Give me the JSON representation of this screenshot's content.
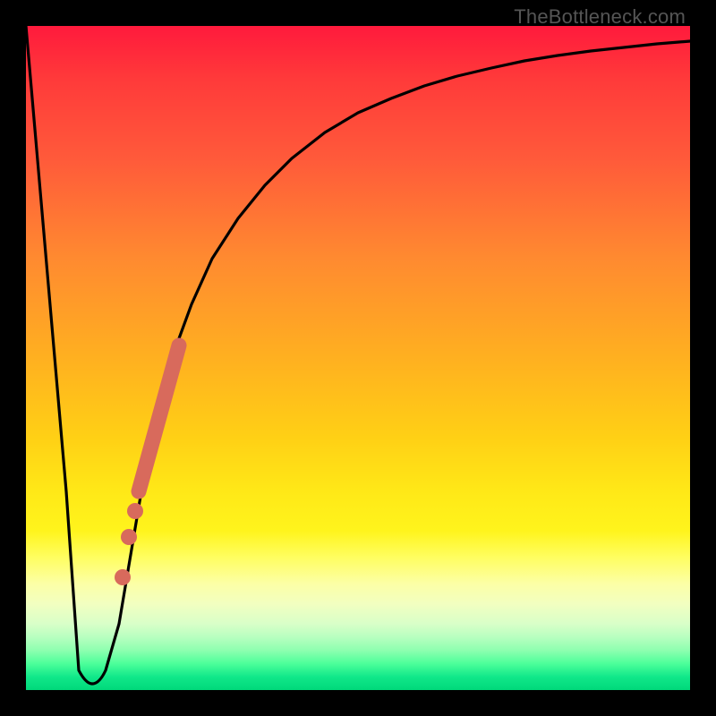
{
  "watermark": "TheBottleneck.com",
  "chart_data": {
    "type": "line",
    "title": "",
    "xlabel": "",
    "ylabel": "",
    "xlim": [
      0,
      100
    ],
    "ylim": [
      0,
      100
    ],
    "grid": false,
    "legend": false,
    "series": [
      {
        "name": "bottleneck-curve",
        "x": [
          0,
          6,
          8,
          10,
          12,
          14,
          16,
          18,
          20,
          22,
          25,
          28,
          32,
          36,
          40,
          45,
          50,
          55,
          60,
          65,
          70,
          75,
          80,
          85,
          90,
          95,
          100
        ],
        "values": [
          100,
          30,
          3,
          2,
          3,
          10,
          22,
          34,
          43,
          50,
          58,
          65,
          71,
          76,
          80,
          84,
          87,
          89,
          91,
          92.5,
          93.7,
          94.7,
          95.5,
          96.2,
          96.8,
          97.3,
          97.7
        ]
      }
    ],
    "markers": {
      "name": "highlight-segment",
      "color": "#d86a5c",
      "segment": {
        "x1": 17,
        "y1": 30,
        "x2": 23,
        "y2": 52,
        "width": 14
      },
      "dots": [
        {
          "x": 16.5,
          "y": 27,
          "r": 7
        },
        {
          "x": 15.5,
          "y": 23,
          "r": 7
        },
        {
          "x": 14.5,
          "y": 17,
          "r": 7
        }
      ]
    }
  }
}
